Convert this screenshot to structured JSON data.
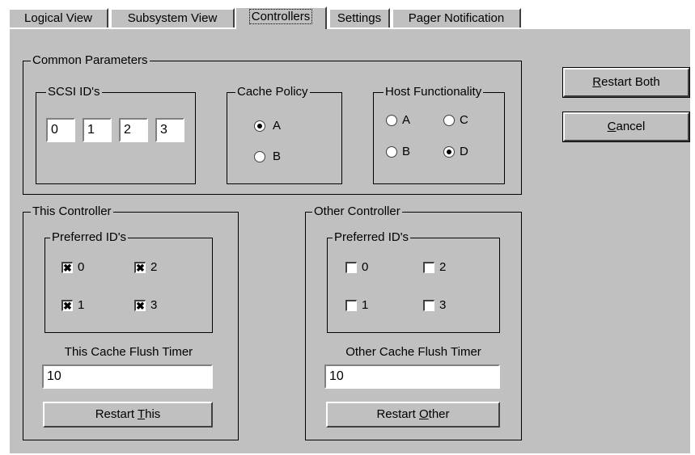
{
  "tabs": [
    {
      "label": "Logical View"
    },
    {
      "label": "Subsystem View"
    },
    {
      "label": "Controllers",
      "active": true
    },
    {
      "label": "Settings"
    },
    {
      "label": "Pager Notification"
    }
  ],
  "common": {
    "title": "Common Parameters",
    "scsi": {
      "title": "SCSI ID's",
      "ids": [
        "0",
        "1",
        "2",
        "3"
      ]
    },
    "cache_policy": {
      "title": "Cache Policy",
      "options": [
        {
          "label": "A",
          "selected": true
        },
        {
          "label": "B",
          "selected": false
        }
      ]
    },
    "host_functionality": {
      "title": "Host Functionality",
      "options": [
        {
          "label": "A",
          "selected": false
        },
        {
          "label": "C",
          "selected": false
        },
        {
          "label": "B",
          "selected": false
        },
        {
          "label": "D",
          "selected": true
        }
      ]
    }
  },
  "this_controller": {
    "title": "This Controller",
    "preferred_title": "Preferred ID's",
    "ids": [
      {
        "label": "0",
        "checked": true
      },
      {
        "label": "2",
        "checked": true
      },
      {
        "label": "1",
        "checked": true
      },
      {
        "label": "3",
        "checked": true
      }
    ],
    "timer_label": "This Cache Flush Timer",
    "timer_value": "10",
    "restart_pre": "Restart ",
    "restart_key": "T",
    "restart_post": "his"
  },
  "other_controller": {
    "title": "Other Controller",
    "preferred_title": "Preferred ID's",
    "ids": [
      {
        "label": "0",
        "checked": false
      },
      {
        "label": "2",
        "checked": false
      },
      {
        "label": "1",
        "checked": false
      },
      {
        "label": "3",
        "checked": false
      }
    ],
    "timer_label": "Other Cache Flush Timer",
    "timer_value": "10",
    "restart_pre": "Restart ",
    "restart_key": "O",
    "restart_post": "ther"
  },
  "buttons": {
    "restart_both_key": "R",
    "restart_both_rest": "estart Both",
    "cancel_key": "C",
    "cancel_rest": "ancel"
  },
  "check_mark": "✖"
}
